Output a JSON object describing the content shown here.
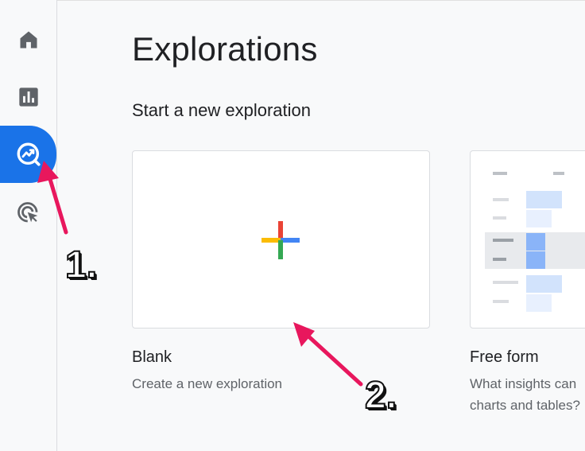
{
  "sidebar": {
    "items": [
      {
        "name": "home-icon",
        "active": false
      },
      {
        "name": "reports-icon",
        "active": false
      },
      {
        "name": "explore-icon",
        "active": true
      },
      {
        "name": "advertising-icon",
        "active": false
      }
    ]
  },
  "main": {
    "title": "Explorations",
    "section_title": "Start a new exploration",
    "cards": [
      {
        "title": "Blank",
        "description": "Create a new exploration"
      },
      {
        "title": "Free form",
        "description_line1": "What insights can",
        "description_line2": "charts and tables?"
      }
    ]
  },
  "annotations": {
    "step1": "1.",
    "step2": "2."
  },
  "colors": {
    "active_nav": "#1a73e8",
    "annotation_arrow": "#e8175d",
    "plus_red": "#ea4335",
    "plus_blue": "#4285f4",
    "plus_yellow": "#fbbc04",
    "plus_green": "#34a853"
  }
}
